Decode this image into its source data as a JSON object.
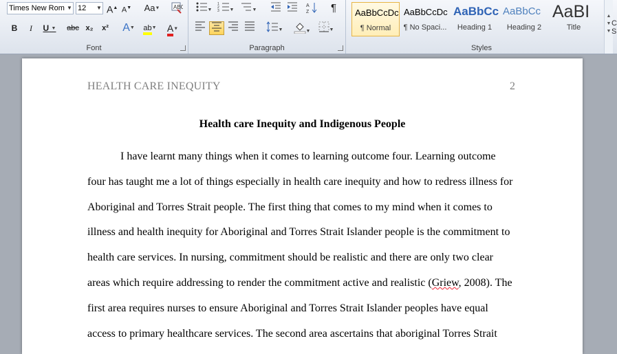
{
  "ribbon": {
    "font": {
      "label": "Font",
      "font_name": "Times New Rom",
      "font_size": "12",
      "grow": "A",
      "shrink": "A",
      "change_case": "Aa",
      "bold": "B",
      "italic": "I",
      "underline": "U",
      "strikethrough": "abc",
      "subscript": "x₂",
      "superscript": "x²",
      "text_effects": "A",
      "highlight": "ab",
      "font_color": "A"
    },
    "paragraph": {
      "label": "Paragraph",
      "pilcrow": "¶"
    },
    "styles": {
      "label": "Styles",
      "items": [
        {
          "sample": "AaBbCcDc",
          "name": "¶ Normal",
          "selected": true
        },
        {
          "sample": "AaBbCcDc",
          "name": "¶ No Spaci...",
          "selected": false
        },
        {
          "sample": "AaBbCc",
          "name": "Heading 1",
          "selected": false
        },
        {
          "sample": "AaBbCc",
          "name": "Heading 2",
          "selected": false
        },
        {
          "sample": "AaBI",
          "name": "Title",
          "selected": false
        }
      ],
      "change_styles_partial": "C",
      "change_styles_partial2": "S"
    }
  },
  "document": {
    "running_head": "HEALTH CARE INEQUITY",
    "page_number": "2",
    "title": "Health care Inequity and Indigenous People",
    "lines": [
      "I have learnt many things when it comes to learning outcome four. Learning outcome",
      "four has taught me a lot of things especially in health care inequity and how to redress illness  for",
      "Aboriginal and Torres Strait people. The first thing that comes to my mind when it comes to",
      "illness and health inequity for Aboriginal and Torres Strait Islander people is the commitment to",
      "health care services. In nursing, commitment should be realistic and there are only two clear",
      "areas which require addressing to render the commitment active and realistic (",
      "Griew",
      ", 2008). The",
      "first area requires nurses to ensure Aboriginal and Torres Strait Islander peoples have equal",
      "access to primary healthcare services. The second area ascertains that aboriginal Torres Strait"
    ]
  }
}
